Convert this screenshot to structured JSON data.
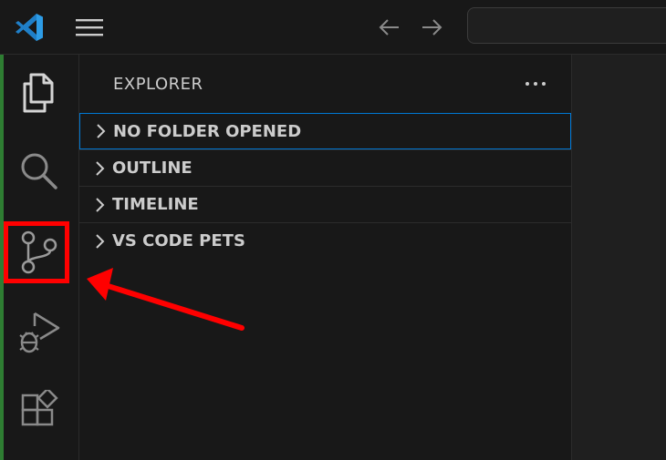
{
  "sidebar": {
    "title": "EXPLORER",
    "sections": [
      {
        "label": "NO FOLDER OPENED"
      },
      {
        "label": "OUTLINE"
      },
      {
        "label": "TIMELINE"
      },
      {
        "label": "VS CODE PETS"
      }
    ]
  },
  "activity_bar": {
    "items": [
      "files-icon",
      "search-icon",
      "source-control-icon",
      "run-debug-icon",
      "extensions-icon"
    ]
  },
  "colors": {
    "accent": "#0078d4",
    "annotation": "#ff0000",
    "logo": "#2d9ce6"
  }
}
